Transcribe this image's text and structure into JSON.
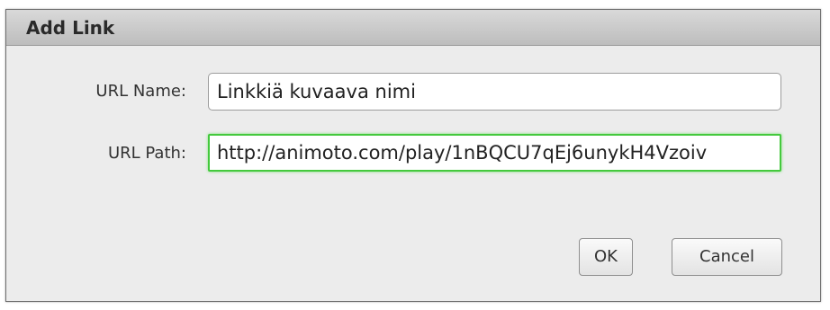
{
  "dialog": {
    "title": "Add Link",
    "url_name": {
      "label": "URL Name:",
      "value": "Linkkiä kuvaava nimi"
    },
    "url_path": {
      "label": "URL Path:",
      "value": "http://animoto.com/play/1nBQCU7qEj6unykH4Vzoiv"
    },
    "buttons": {
      "ok": "OK",
      "cancel": "Cancel"
    }
  },
  "colors": {
    "focus_border": "#44c93d",
    "titlebar": "#c9c9c9",
    "dialog_bg": "#ececec"
  }
}
